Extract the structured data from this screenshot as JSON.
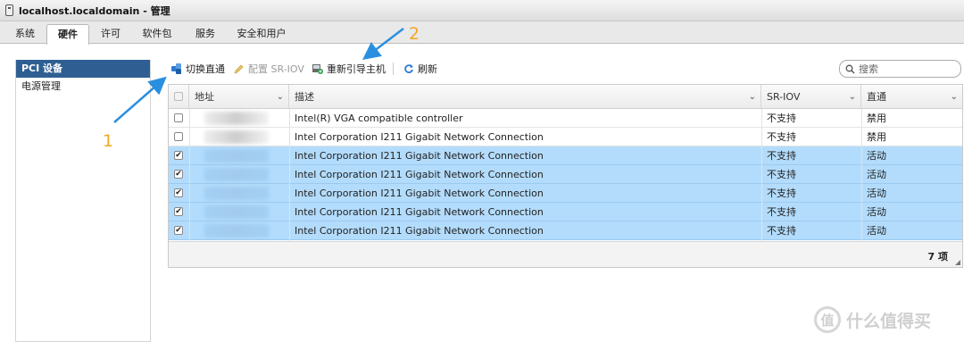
{
  "window": {
    "title": "localhost.localdomain - 管理"
  },
  "tabs": [
    {
      "label": "系统"
    },
    {
      "label": "硬件",
      "active": true
    },
    {
      "label": "许可"
    },
    {
      "label": "软件包"
    },
    {
      "label": "服务"
    },
    {
      "label": "安全和用户"
    }
  ],
  "sidebar": {
    "items": [
      {
        "label": "PCI 设备",
        "active": true
      },
      {
        "label": "电源管理"
      }
    ]
  },
  "toolbar": {
    "toggle_passthrough": {
      "label": "切换直通",
      "icon": "passthrough-icon"
    },
    "configure_sriov": {
      "label": "配置 SR-IOV",
      "icon": "pencil-icon",
      "disabled": true
    },
    "reboot_host": {
      "label": "重新引导主机",
      "icon": "reboot-icon"
    },
    "refresh": {
      "label": "刷新",
      "icon": "refresh-icon"
    },
    "search_placeholder": "搜索"
  },
  "table": {
    "columns": [
      "地址",
      "描述",
      "SR-IOV",
      "直通"
    ],
    "rows": [
      {
        "checked": false,
        "selected": false,
        "description": "Intel(R) VGA compatible controller",
        "sriov": "不支持",
        "passthrough": "禁用"
      },
      {
        "checked": false,
        "selected": false,
        "description": "Intel Corporation I211 Gigabit Network Connection",
        "sriov": "不支持",
        "passthrough": "禁用"
      },
      {
        "checked": true,
        "selected": true,
        "description": "Intel Corporation I211 Gigabit Network Connection",
        "sriov": "不支持",
        "passthrough": "活动"
      },
      {
        "checked": true,
        "selected": true,
        "description": "Intel Corporation I211 Gigabit Network Connection",
        "sriov": "不支持",
        "passthrough": "活动"
      },
      {
        "checked": true,
        "selected": true,
        "description": "Intel Corporation I211 Gigabit Network Connection",
        "sriov": "不支持",
        "passthrough": "活动"
      },
      {
        "checked": true,
        "selected": true,
        "description": "Intel Corporation I211 Gigabit Network Connection",
        "sriov": "不支持",
        "passthrough": "活动"
      },
      {
        "checked": true,
        "selected": true,
        "description": "Intel Corporation I211 Gigabit Network Connection",
        "sriov": "不支持",
        "passthrough": "活动"
      }
    ],
    "footer_count": "7 项"
  },
  "annotations": {
    "step1": "1",
    "step2": "2",
    "arrow_color": "#2b8fe0",
    "label_color": "#f5a623"
  },
  "watermark": {
    "text": "什么值得买",
    "logo_char": "值"
  },
  "colors": {
    "selected_row": "#b3dcfc",
    "sidebar_active": "#2f5f92"
  }
}
